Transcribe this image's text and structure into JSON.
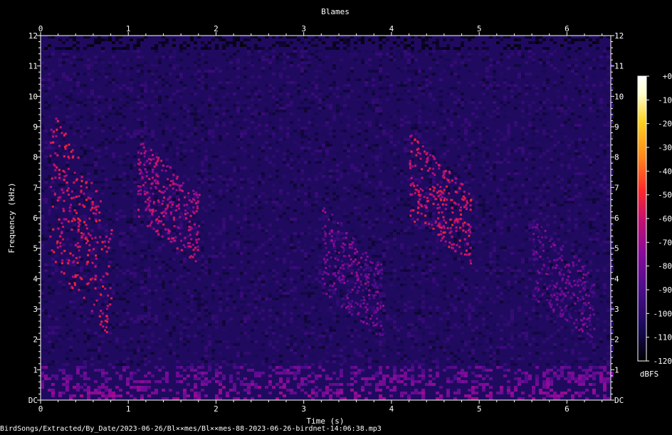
{
  "chart_data": {
    "type": "heatmap",
    "title": "Blames",
    "xlabel": "Time (s)",
    "ylabel": "Frequency (kHz)",
    "xlim": [
      0,
      6.5
    ],
    "ylim": [
      0,
      12
    ],
    "x_ticks": [
      "0",
      "1",
      "2",
      "3",
      "4",
      "5",
      "6"
    ],
    "y_ticks": [
      "DC",
      "1",
      "2",
      "3",
      "4",
      "5",
      "6",
      "7",
      "8",
      "9",
      "10",
      "11",
      "12"
    ],
    "colorbar": {
      "label": "dBFS",
      "range": [
        -120,
        0
      ],
      "ticks": [
        "+0",
        "-10",
        "-20",
        "-30",
        "-40",
        "-50",
        "-60",
        "-70",
        "-80",
        "-90",
        "-100",
        "-110",
        "-120"
      ],
      "colors": [
        "#000000",
        "#1a0a5a",
        "#4b0c8c",
        "#8a0a9a",
        "#c8106e",
        "#ff2828",
        "#ff8a1a",
        "#ffd21e",
        "#ffffd0",
        "#ffffff"
      ]
    },
    "background_level_dbfs": -105,
    "low_frequency_band": {
      "fmax_khz": 1.2,
      "level_dbfs": -90
    },
    "calls": [
      {
        "t_start": 0.1,
        "t_end": 0.8,
        "f_low": 2.0,
        "f_high": 9.7,
        "level_dbfs": -62
      },
      {
        "t_start": 1.1,
        "t_end": 1.8,
        "f_low": 4.5,
        "f_high": 8.7,
        "level_dbfs": -70
      },
      {
        "t_start": 3.2,
        "t_end": 3.9,
        "f_low": 2.0,
        "f_high": 6.5,
        "level_dbfs": -82
      },
      {
        "t_start": 4.2,
        "t_end": 4.9,
        "f_low": 4.5,
        "f_high": 8.8,
        "level_dbfs": -64
      },
      {
        "t_start": 5.6,
        "t_end": 6.3,
        "f_low": 2.0,
        "f_high": 6.0,
        "level_dbfs": -86
      }
    ]
  },
  "footer": {
    "filepath": "BirdSongs/Extracted/By_Date/2023-06-26/Bl××mes/Bl××mes-88-2023-06-26-birdnet-14:06:38.mp3"
  }
}
